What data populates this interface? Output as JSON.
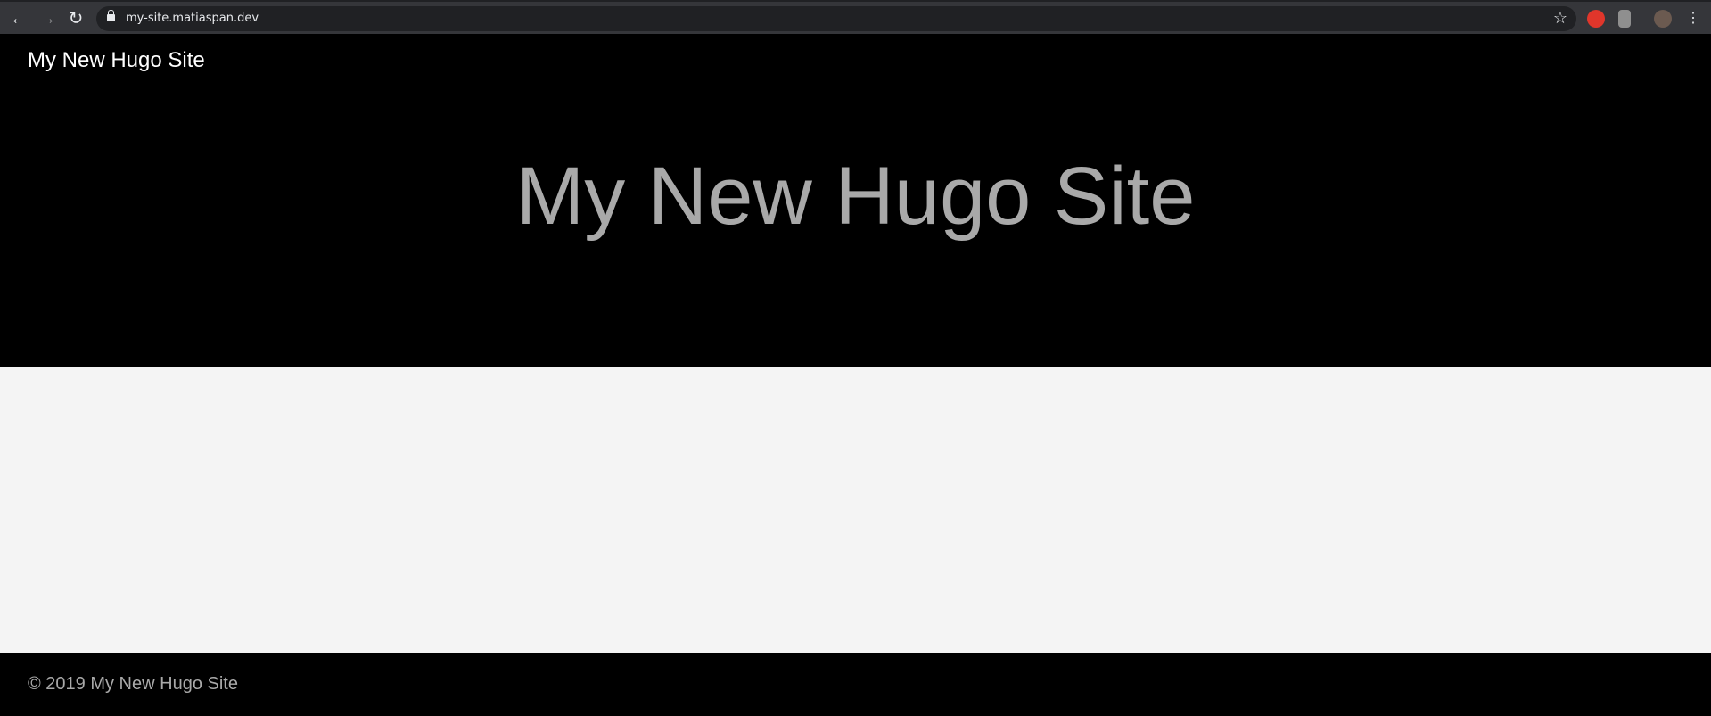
{
  "browser": {
    "url": "my-site.matiaspan.dev",
    "icons": [
      "back-icon",
      "forward-icon",
      "reload-icon",
      "lock-icon",
      "star-icon",
      "adblock-icon",
      "extension-icon",
      "avatar",
      "menu-icon"
    ]
  },
  "header": {
    "brand": "My New Hugo Site",
    "hero_title": "My New Hugo Site"
  },
  "footer": {
    "copyright": "© 2019 My New Hugo Site"
  },
  "colors": {
    "header_bg": "#000000",
    "body_bg": "#f4f4f4",
    "hero_text": "#a9a9a9"
  }
}
